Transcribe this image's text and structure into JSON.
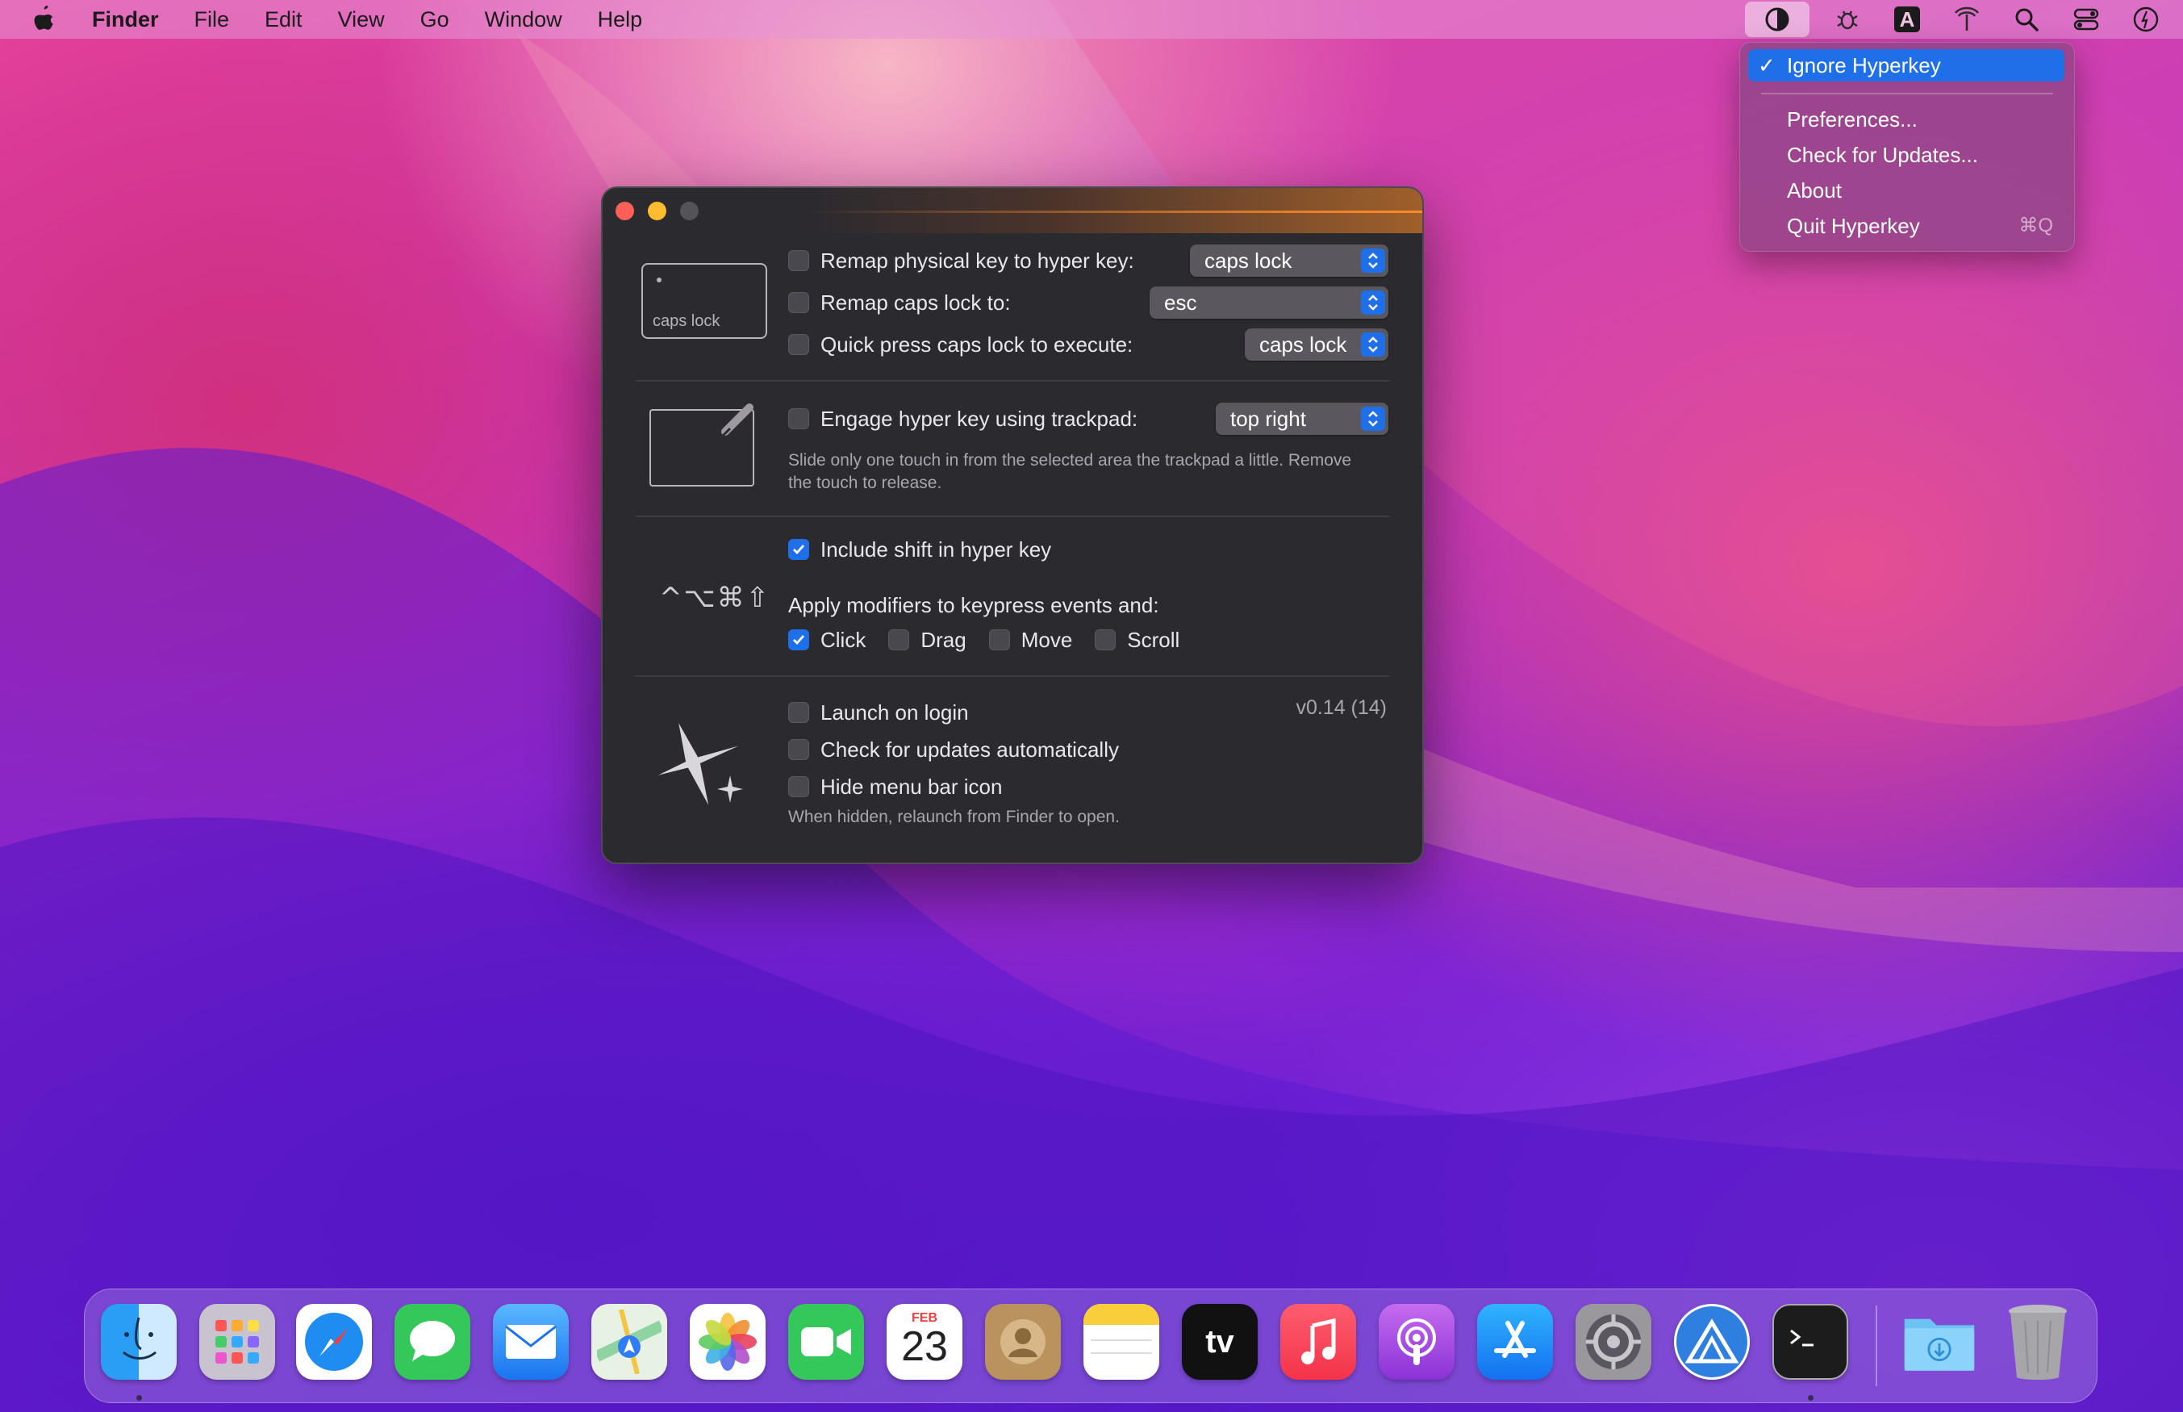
{
  "menubar": {
    "app_name": "Finder",
    "menus": [
      "File",
      "Edit",
      "View",
      "Go",
      "Window",
      "Help"
    ],
    "status_icons": [
      "hyperkey-icon",
      "debug-icon",
      "input-source-icon",
      "antenna-icon",
      "spotlight-icon",
      "control-center-icon",
      "siri-icon"
    ],
    "input_source_letter": "A"
  },
  "dropdown": {
    "items": [
      {
        "label": "Ignore Hyperkey",
        "checked": true
      },
      {
        "label": "Preferences..."
      },
      {
        "label": "Check for Updates..."
      },
      {
        "label": "About"
      },
      {
        "label": "Quit Hyperkey",
        "shortcut": "⌘Q"
      }
    ],
    "check_glyph": "✓"
  },
  "window": {
    "keycap_label": "caps lock",
    "remap_physical": {
      "label": "Remap physical key to hyper key:",
      "checked": false,
      "value": "caps lock"
    },
    "remap_caps": {
      "label": "Remap caps lock to:",
      "checked": false,
      "value": "esc"
    },
    "quick_press": {
      "label": "Quick press caps lock to execute:",
      "checked": false,
      "value": "caps lock"
    },
    "trackpad": {
      "label": "Engage hyper key using trackpad:",
      "checked": false,
      "value": "top right",
      "help": "Slide only one touch in from the selected area the trackpad a little. Remove the touch to release."
    },
    "include_shift": {
      "label": "Include shift in hyper key",
      "checked": true
    },
    "modifier_symbols": "^⌥⌘⇧",
    "apply_modifiers": {
      "label": "Apply modifiers to keypress events and:",
      "options": [
        {
          "label": "Click",
          "checked": true
        },
        {
          "label": "Drag",
          "checked": false
        },
        {
          "label": "Move",
          "checked": false
        },
        {
          "label": "Scroll",
          "checked": false
        }
      ]
    },
    "launch_on_login": {
      "label": "Launch on login",
      "checked": false
    },
    "check_updates": {
      "label": "Check for updates automatically",
      "checked": false
    },
    "hide_icon": {
      "label": "Hide menu bar icon",
      "checked": false
    },
    "hide_help": "When hidden, relaunch from Finder to open.",
    "version": "v0.14 (14)"
  },
  "dock": {
    "apps": [
      "Finder",
      "Launchpad",
      "Safari",
      "Messages",
      "Mail",
      "Maps",
      "Photos",
      "FaceTime",
      "Calendar",
      "Contacts",
      "Notes",
      "TV",
      "Music",
      "Podcasts",
      "App Store",
      "System Preferences",
      "Hyperkey",
      "Terminal",
      "Downloads",
      "Trash"
    ],
    "calendar": {
      "month": "FEB",
      "day": "23"
    },
    "tv_label": "tv"
  },
  "colors": {
    "accent": "#1f6fe8",
    "window_bg": "#2b2a2f",
    "menu_bg": "#914687"
  }
}
